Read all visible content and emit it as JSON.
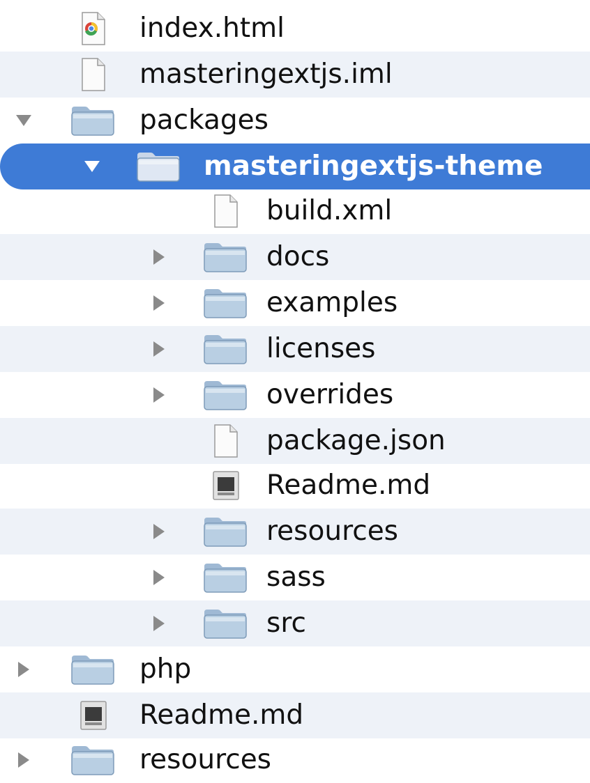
{
  "tree": {
    "selected_color": "#3e7bd6",
    "items": [
      {
        "label": "index.html",
        "icon": "html-file-icon",
        "depth": 1,
        "expander": "none"
      },
      {
        "label": "masteringextjs.iml",
        "icon": "file-icon",
        "depth": 1,
        "expander": "none"
      },
      {
        "label": "packages",
        "icon": "folder-icon",
        "depth": 1,
        "expander": "expanded"
      },
      {
        "label": "masteringextjs-theme",
        "icon": "folder-icon",
        "depth": 2,
        "expander": "expanded",
        "selected": true
      },
      {
        "label": "build.xml",
        "icon": "file-icon",
        "depth": 3,
        "expander": "none"
      },
      {
        "label": "docs",
        "icon": "folder-icon",
        "depth": 3,
        "expander": "collapsed"
      },
      {
        "label": "examples",
        "icon": "folder-icon",
        "depth": 3,
        "expander": "collapsed"
      },
      {
        "label": "licenses",
        "icon": "folder-icon",
        "depth": 3,
        "expander": "collapsed"
      },
      {
        "label": "overrides",
        "icon": "folder-icon",
        "depth": 3,
        "expander": "collapsed"
      },
      {
        "label": "package.json",
        "icon": "file-icon",
        "depth": 3,
        "expander": "none"
      },
      {
        "label": "Readme.md",
        "icon": "document-icon",
        "depth": 3,
        "expander": "none"
      },
      {
        "label": "resources",
        "icon": "folder-icon",
        "depth": 3,
        "expander": "collapsed"
      },
      {
        "label": "sass",
        "icon": "folder-icon",
        "depth": 3,
        "expander": "collapsed"
      },
      {
        "label": "src",
        "icon": "folder-icon",
        "depth": 3,
        "expander": "collapsed"
      },
      {
        "label": "php",
        "icon": "folder-icon",
        "depth": 1,
        "expander": "collapsed"
      },
      {
        "label": "Readme.md",
        "icon": "document-icon",
        "depth": 1,
        "expander": "none"
      },
      {
        "label": "resources",
        "icon": "folder-icon",
        "depth": 1,
        "expander": "collapsed"
      }
    ]
  }
}
